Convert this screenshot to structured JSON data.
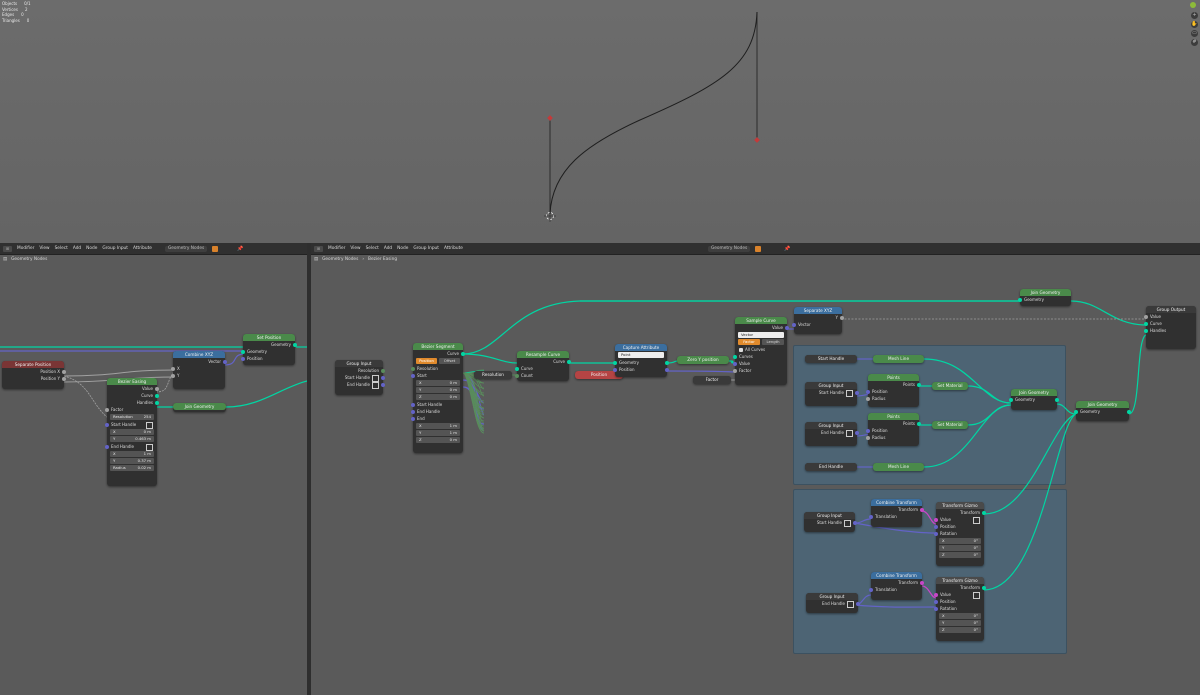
{
  "viewport": {
    "stats": [
      {
        "label": "Objects",
        "value": "0/1"
      },
      {
        "label": "Vertices",
        "value": "2"
      },
      {
        "label": "Edges",
        "value": "0"
      },
      {
        "label": "Triangles",
        "value": "0"
      }
    ]
  },
  "left_editor": {
    "header": {
      "mode": "Modifier",
      "menus": [
        "View",
        "Select",
        "Add",
        "Node",
        "Group Input",
        "Attribute"
      ],
      "tree_name": "Geometry Nodes"
    },
    "breadcrumb": [
      "Geometry Nodes"
    ],
    "nodes": {
      "separate_position": {
        "title": "Separate Position",
        "outputs": [
          "Position X",
          "Position Y"
        ]
      },
      "combine_xyz": {
        "title": "Combine XYZ",
        "output": "Vector",
        "inputs": [
          "X",
          "Y"
        ]
      },
      "set_position": {
        "title": "Set Position",
        "output": "Geometry",
        "inputs": [
          "Geometry",
          "Position"
        ]
      },
      "bezier_easing": {
        "title": "Bezier Easing",
        "outputs": [
          "Value",
          "Curve",
          "Handles"
        ],
        "factor": "Factor",
        "resolution": {
          "label": "Resolution",
          "value": "254"
        },
        "start_handle": "Start Handle",
        "start_x": {
          "label": "X",
          "value": "0 m"
        },
        "start_y": {
          "label": "Y",
          "value": "0.463 m"
        },
        "end_handle": "End Handle",
        "end_x": {
          "label": "X",
          "value": "1 m"
        },
        "end_y": {
          "label": "Y",
          "value": "0.37 m"
        },
        "radius": {
          "label": "Radius",
          "value": "0.02 m"
        }
      },
      "join_geometry": {
        "title": "Join Geometry"
      }
    }
  },
  "right_editor": {
    "header": {
      "mode": "Modifier",
      "menus": [
        "View",
        "Select",
        "Add",
        "Node",
        "Group Input",
        "Attribute"
      ],
      "tree_name": "Geometry Nodes"
    },
    "breadcrumb": [
      "Geometry Nodes",
      "Bezier Easing"
    ],
    "nodes": {
      "group_input_main": {
        "title": "Group Input",
        "outputs": [
          "Resolution",
          "Start Handle",
          "End Handle"
        ]
      },
      "bezier_segment": {
        "title": "Bezier Segment",
        "output": "Curve",
        "mode_a": "Position",
        "mode_b": "Offset",
        "inputs": [
          "Resolution",
          "Start"
        ],
        "start": [
          {
            "label": "X",
            "value": "0 m"
          },
          {
            "label": "Y",
            "value": "0 m"
          },
          {
            "label": "Z",
            "value": "0 m"
          }
        ],
        "mid_inputs": [
          "Start Handle",
          "End Handle",
          "End"
        ],
        "end": [
          {
            "label": "X",
            "value": "1 m"
          },
          {
            "label": "Y",
            "value": "1 m"
          },
          {
            "label": "Z",
            "value": "0 m"
          }
        ]
      },
      "resample_curve": {
        "title": "Resample Curve",
        "output": "Curve",
        "inputs": [
          "Curve",
          "Count"
        ]
      },
      "resolution_reroute": {
        "label": "Resolution"
      },
      "position": {
        "title": "Position"
      },
      "capture_attribute": {
        "title": "Capture Attribute",
        "domain": "Point",
        "outputs": [
          "Geometry",
          "Position"
        ]
      },
      "zero_y": {
        "title": "Zero Y position"
      },
      "factor_reroute": {
        "label": "Factor"
      },
      "sample_curve": {
        "title": "Sample Curve",
        "output": "Value",
        "type": "Vector",
        "mode_a": "Factor",
        "mode_b": "Length",
        "all_curves": "All Curves",
        "inputs": [
          "Curves",
          "Value",
          "Factor"
        ]
      },
      "separate_xyz": {
        "title": "Separate XYZ",
        "output": "Y",
        "input": "Vector"
      },
      "join_top": {
        "title": "Join Geometry",
        "input": "Geometry"
      },
      "group_output": {
        "title": "Group Output",
        "inputs": [
          "Value",
          "Curve",
          "Handles"
        ]
      },
      "start_handle_reroute": {
        "label": "Start Handle"
      },
      "end_handle_reroute": {
        "label": "End Handle"
      },
      "mesh_line_1": {
        "title": "Mesh Line"
      },
      "mesh_line_2": {
        "title": "Mesh Line"
      },
      "gi_start": {
        "title": "Group Input",
        "output": "Start Handle"
      },
      "gi_end": {
        "title": "Group Input",
        "output": "End Handle"
      },
      "points_1": {
        "title": "Points",
        "output": "Points",
        "inputs": [
          "Position",
          "Radius"
        ]
      },
      "points_2": {
        "title": "Points",
        "output": "Points",
        "inputs": [
          "Position",
          "Radius"
        ]
      },
      "set_material_1": {
        "title": "Set Material"
      },
      "set_material_2": {
        "title": "Set Material"
      },
      "join_inner": {
        "title": "Join Geometry",
        "input": "Geometry"
      },
      "join_outer": {
        "title": "Join Geometry",
        "input": "Geometry"
      },
      "gi_start_b": {
        "title": "Group Input",
        "output": "Start Handle"
      },
      "gi_end_b": {
        "title": "Group Input",
        "output": "End Handle"
      },
      "combine_transform_1": {
        "title": "Combine Transform",
        "output": "Transform",
        "input": "Translation"
      },
      "combine_transform_2": {
        "title": "Combine Transform",
        "output": "Transform",
        "input": "Translation"
      },
      "gizmo_1": {
        "title": "Transform Gizmo",
        "output": "Transform",
        "inputs": [
          "Value",
          "Position",
          "Rotation"
        ],
        "rot": [
          {
            "label": "X",
            "value": "0°"
          },
          {
            "label": "Y",
            "value": "0°"
          },
          {
            "label": "Z",
            "value": "0°"
          }
        ]
      },
      "gizmo_2": {
        "title": "Transform Gizmo",
        "output": "Transform",
        "inputs": [
          "Value",
          "Position",
          "Rotation"
        ],
        "rot": [
          {
            "label": "X",
            "value": "0°"
          },
          {
            "label": "Y",
            "value": "0°"
          },
          {
            "label": "Z",
            "value": "0°"
          }
        ]
      }
    }
  },
  "colors": {
    "geometry_socket": "#00d6a3",
    "vector_socket": "#6363c7",
    "float_socket": "#a1a1a1",
    "frame": "#4d6474",
    "selection_accent": "#d9822b"
  }
}
